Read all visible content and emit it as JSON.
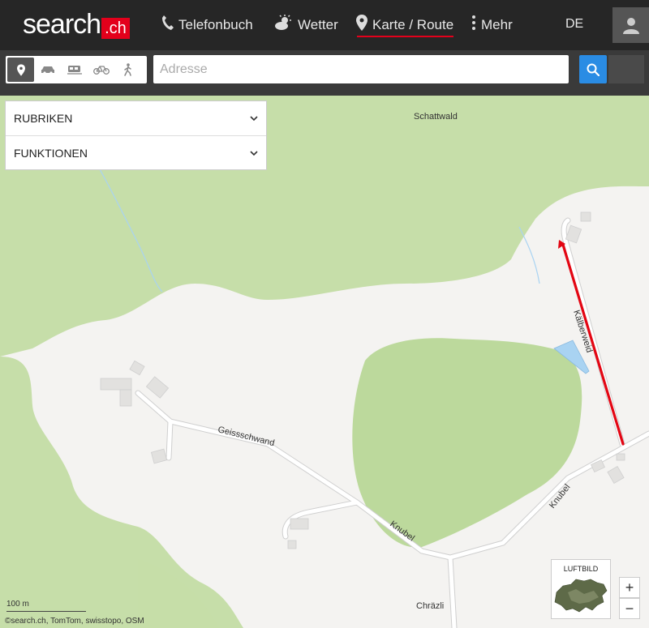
{
  "brand": {
    "logo_text": "search",
    "logo_badge": ".ch"
  },
  "nav": {
    "phonebook": "Telefonbuch",
    "weather": "Wetter",
    "map_route": "Karte / Route",
    "more": "Mehr",
    "language": "DE"
  },
  "search": {
    "placeholder": "Adresse",
    "modes": [
      "location-pin-icon",
      "car-icon",
      "train-icon",
      "bicycle-icon",
      "walking-icon"
    ]
  },
  "panels": {
    "categories": "RUBRIKEN",
    "functions": "FUNKTIONEN"
  },
  "map": {
    "places": {
      "schattwald": "Schattwald",
      "chraezli": "Chräzli"
    },
    "roads": {
      "geissschwand": "Geissschwand",
      "knubel_west": "Knubel",
      "knubel_east": "Knubel",
      "kalberweid": "Kälberweid"
    },
    "aerial_label": "LUFTBILD",
    "zoom_in": "+",
    "zoom_out": "−",
    "scale": "100 m",
    "attribution": "©search.ch, TomTom, swisstopo, OSM"
  },
  "colors": {
    "brand_red": "#e3001b",
    "search_blue": "#2a8ce4",
    "forest": "#c3dca5",
    "route": "#e30613",
    "water": "#a9d3f2"
  }
}
